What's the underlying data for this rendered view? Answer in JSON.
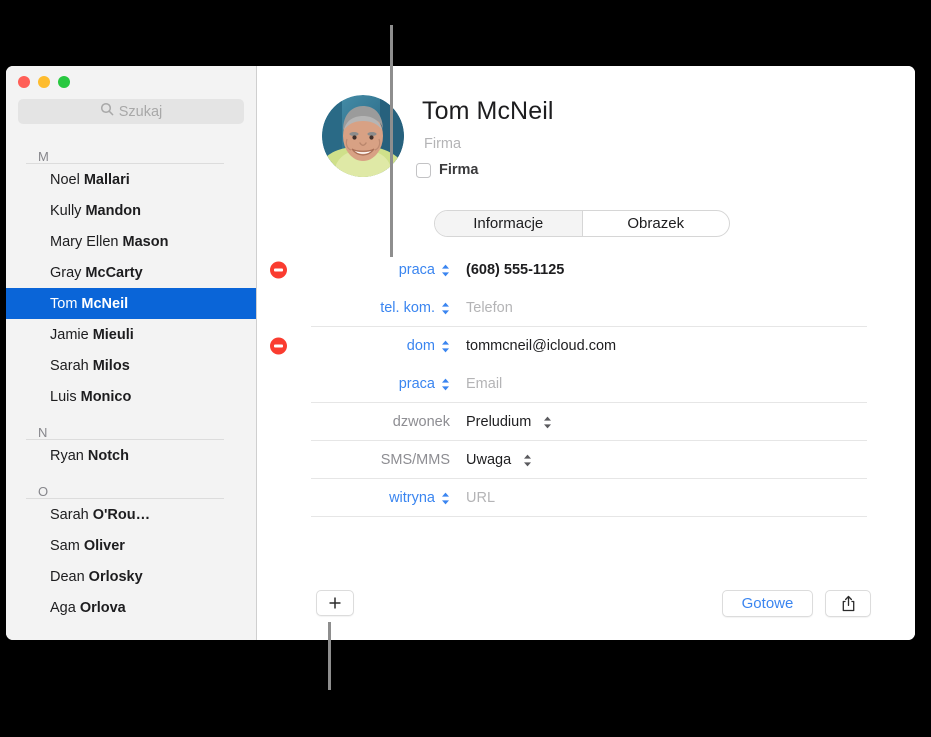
{
  "window": {
    "traffic_lights": [
      {
        "name": "close",
        "color": "#ff5f57"
      },
      {
        "name": "minimize",
        "color": "#febc2e"
      },
      {
        "name": "zoom",
        "color": "#28c840"
      }
    ]
  },
  "search": {
    "placeholder": "Szukaj",
    "icon": "search-icon"
  },
  "sidebar": {
    "sections": [
      {
        "letter": "M",
        "contacts": [
          {
            "first": "Noel",
            "last": "Mallari",
            "selected": false
          },
          {
            "first": "Kully",
            "last": "Mandon",
            "selected": false
          },
          {
            "first": "Mary Ellen",
            "last": "Mason",
            "selected": false
          },
          {
            "first": "Gray",
            "last": "McCarty",
            "selected": false
          },
          {
            "first": "Tom",
            "last": "McNeil",
            "selected": true
          },
          {
            "first": "Jamie",
            "last": "Mieuli",
            "selected": false
          },
          {
            "first": "Sarah",
            "last": "Milos",
            "selected": false
          },
          {
            "first": "Luis",
            "last": "Monico",
            "selected": false
          }
        ]
      },
      {
        "letter": "N",
        "contacts": [
          {
            "first": "Ryan",
            "last": "Notch",
            "selected": false
          }
        ]
      },
      {
        "letter": "O",
        "contacts": [
          {
            "first": "Sarah",
            "last": "O'Rou…",
            "selected": false
          },
          {
            "first": "Sam",
            "last": "Oliver",
            "selected": false
          },
          {
            "first": "Dean",
            "last": "Orlosky",
            "selected": false
          },
          {
            "first": "Aga",
            "last": "Orlova",
            "selected": false
          }
        ]
      }
    ]
  },
  "detail": {
    "avatar_alt": "contact-photo",
    "name_first": "Tom",
    "name_last": "McNeil",
    "company_placeholder": "Firma",
    "company_checkbox_label": "Firma",
    "tabs": [
      {
        "label": "Informacje",
        "active": true
      },
      {
        "label": "Obrazek",
        "active": false
      }
    ],
    "fields": [
      {
        "id": "phone-work",
        "has_remove": true,
        "label": "praca",
        "label_style": "blue",
        "has_stepper": true,
        "value": "(608) 555-1125",
        "value_style": "bold",
        "value_stepper": false,
        "divider": false
      },
      {
        "id": "phone-mobile",
        "has_remove": false,
        "label": "tel. kom.",
        "label_style": "blue",
        "has_stepper": true,
        "value": "Telefon",
        "value_style": "ph",
        "value_stepper": false,
        "divider": true
      },
      {
        "id": "email-home",
        "has_remove": true,
        "label": "dom",
        "label_style": "blue",
        "has_stepper": true,
        "value": "tommcneil@icloud.com",
        "value_style": "plain",
        "value_stepper": false,
        "divider": false
      },
      {
        "id": "email-work",
        "has_remove": false,
        "label": "praca",
        "label_style": "blue",
        "has_stepper": true,
        "value": "Email",
        "value_style": "ph",
        "value_stepper": false,
        "divider": true
      },
      {
        "id": "ringtone",
        "has_remove": false,
        "label": "dzwonek",
        "label_style": "gray",
        "has_stepper": false,
        "value": "Preludium",
        "value_style": "plain",
        "value_stepper": true,
        "divider": true
      },
      {
        "id": "text-tone",
        "has_remove": false,
        "label": "SMS/MMS",
        "label_style": "gray",
        "has_stepper": false,
        "value": "Uwaga",
        "value_style": "plain",
        "value_stepper": true,
        "divider": true
      },
      {
        "id": "website",
        "has_remove": false,
        "label": "witryna",
        "label_style": "blue",
        "has_stepper": true,
        "value": "URL",
        "value_style": "ph",
        "value_stepper": false,
        "divider": true
      }
    ],
    "bottom": {
      "add_label": "+",
      "done_label": "Gotowe",
      "share_icon": "share-icon"
    }
  },
  "colors": {
    "selection_blue": "#0a65d8",
    "link_blue": "#3a85f0",
    "remove_red": "#fa3c30",
    "sidebar_bg": "#f3f3f3",
    "placeholder_gray": "#b4b4b6"
  },
  "callouts": [
    {
      "name": "callout-line-top"
    },
    {
      "name": "callout-line-bottom"
    }
  ]
}
